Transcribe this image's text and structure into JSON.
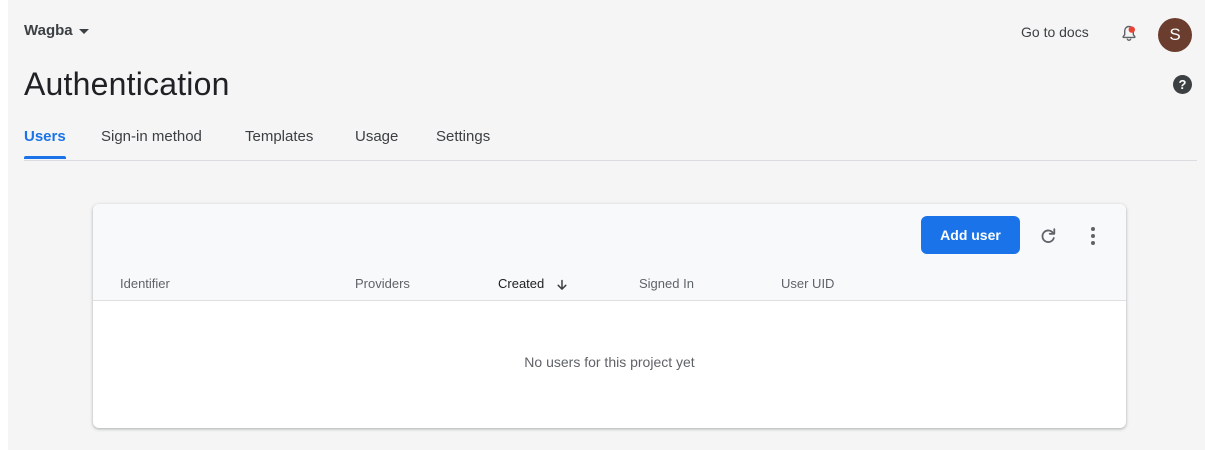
{
  "header": {
    "project_name": "Wagba",
    "docs_link": "Go to docs",
    "avatar_initial": "S"
  },
  "page": {
    "title": "Authentication",
    "help_glyph": "?"
  },
  "tabs": [
    {
      "label": "Users",
      "active": true
    },
    {
      "label": "Sign-in method",
      "active": false
    },
    {
      "label": "Templates",
      "active": false
    },
    {
      "label": "Usage",
      "active": false
    },
    {
      "label": "Settings",
      "active": false
    }
  ],
  "users_table": {
    "add_button_label": "Add user",
    "columns": [
      "Identifier",
      "Providers",
      "Created",
      "Signed In",
      "User UID"
    ],
    "sorted_column": "Created",
    "sort_direction": "descending",
    "empty_message": "No users for this project yet"
  },
  "icons": {
    "project_dropdown": "chevron-down-icon",
    "notifications": "bell-icon",
    "help": "help-icon",
    "refresh": "refresh-icon",
    "more": "more-vert-icon",
    "sort": "arrow-down-icon"
  },
  "colors": {
    "accent": "#1a73e8",
    "avatar_bg": "#6b3d2e",
    "notification_dot": "#ea4335",
    "page_bg": "#f5f5f5"
  }
}
